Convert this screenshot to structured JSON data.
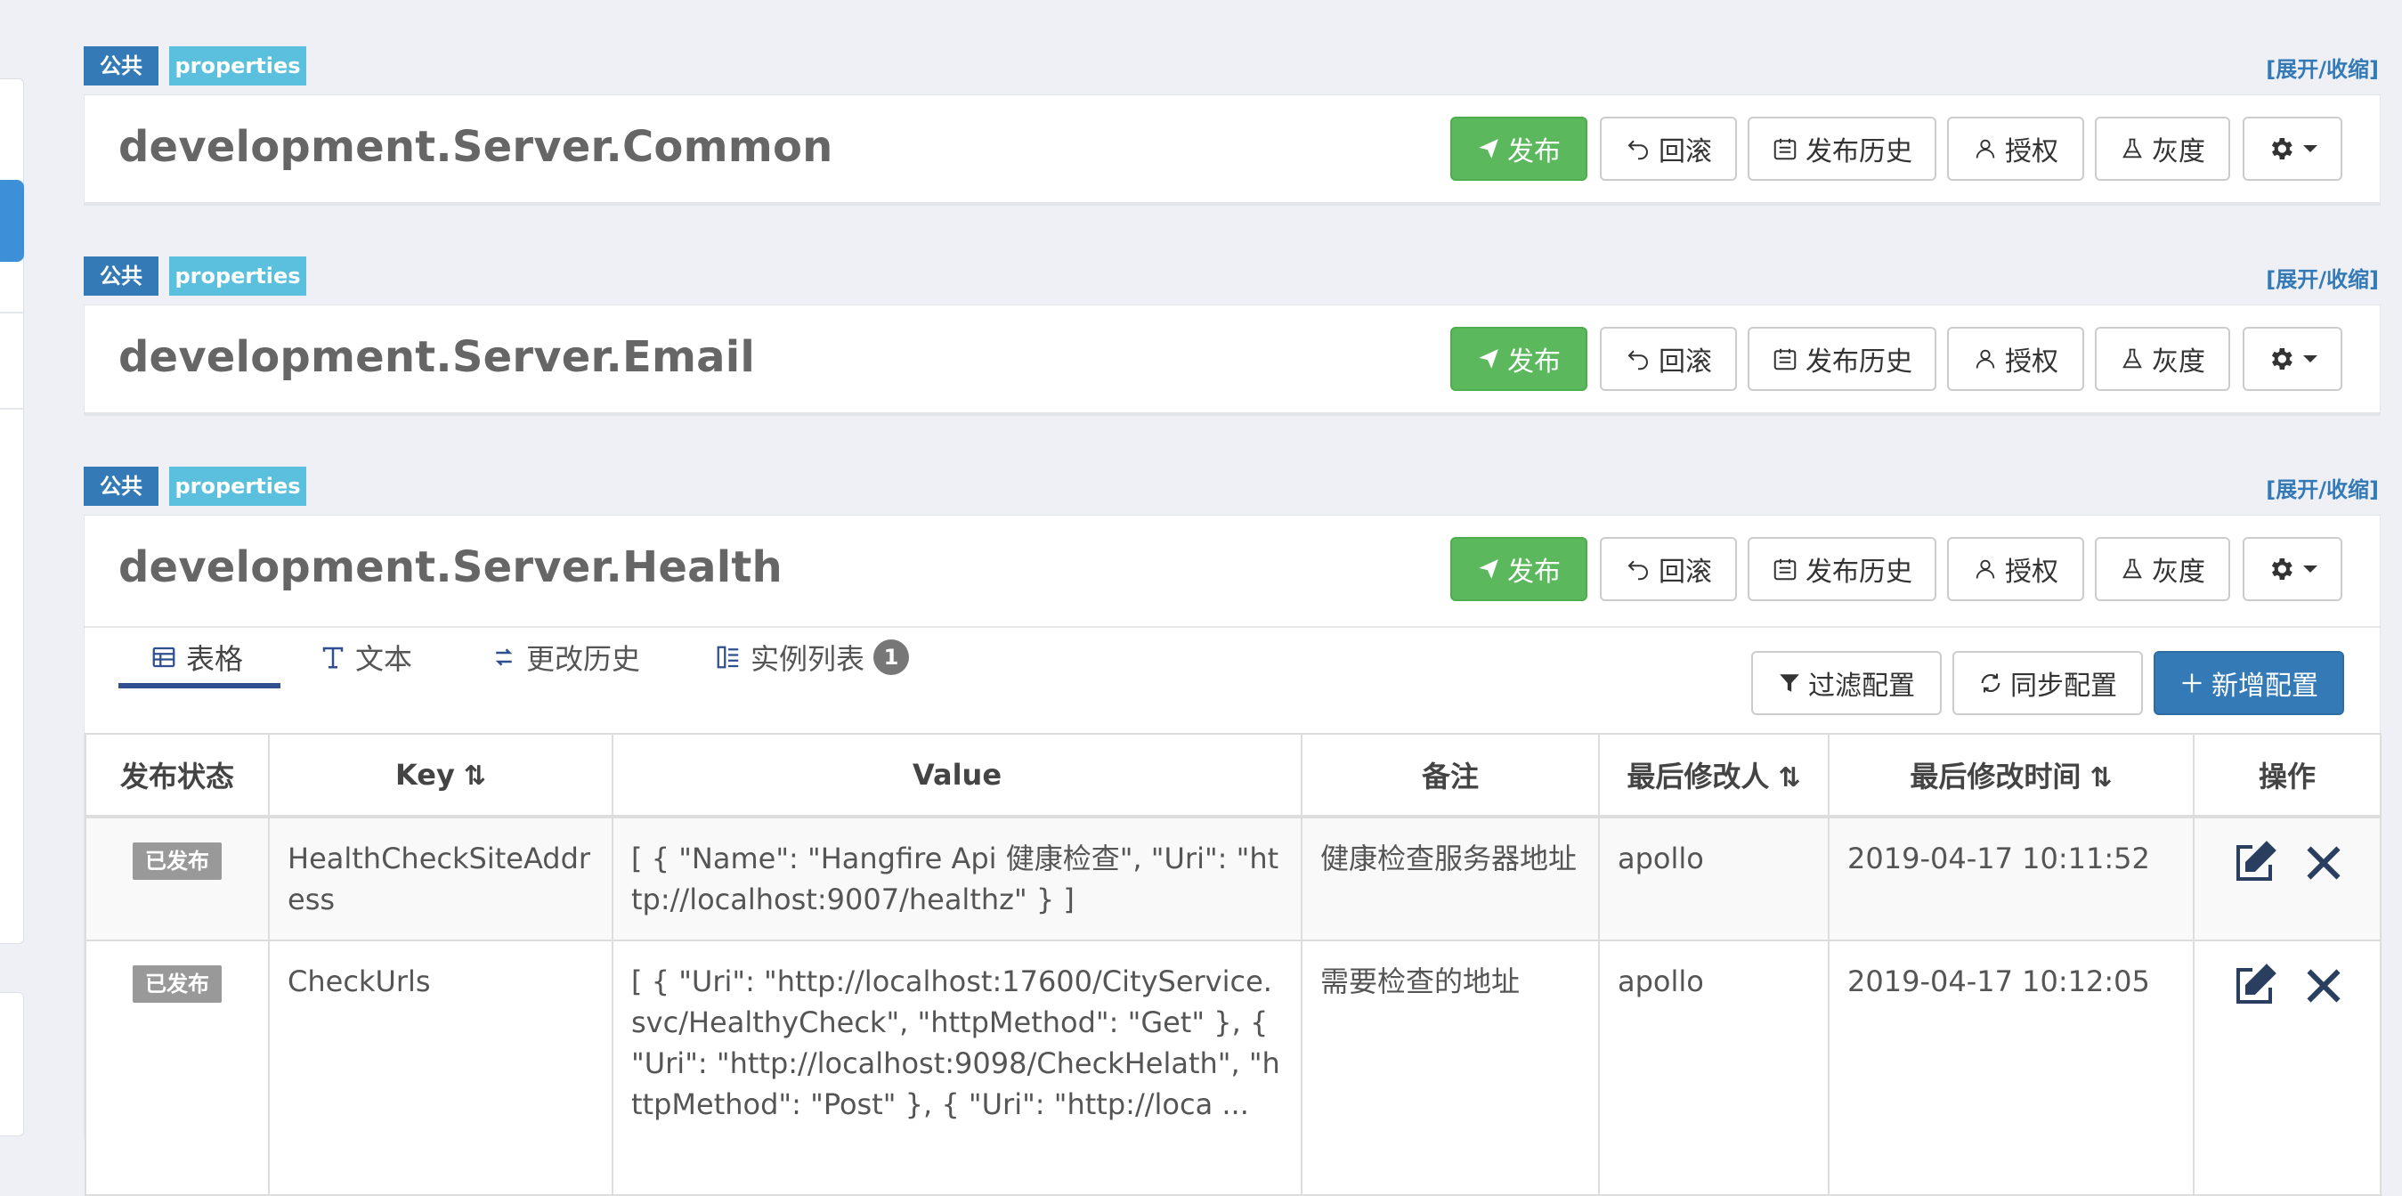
{
  "common": {
    "public_tag": "公共",
    "format_tag": "properties",
    "toggle_link": "[展开/收缩]",
    "buttons": {
      "publish": "发布",
      "rollback": "回滚",
      "history": "发布历史",
      "auth": "授权",
      "gray": "灰度"
    }
  },
  "namespaces": [
    {
      "title": "development.Server.Common"
    },
    {
      "title": "development.Server.Email"
    },
    {
      "title": "development.Server.Health"
    }
  ],
  "tabs": [
    {
      "label": "表格",
      "icon": "table-icon"
    },
    {
      "label": "文本",
      "icon": "text-icon"
    },
    {
      "label": "更改历史",
      "icon": "history-icon"
    },
    {
      "label": "实例列表",
      "icon": "instance-list-icon",
      "badge": "1"
    }
  ],
  "toolbar": {
    "filter": "过滤配置",
    "sync": "同步配置",
    "add": "新增配置"
  },
  "table": {
    "headers": {
      "status": "发布状态",
      "key": "Key",
      "value": "Value",
      "comment": "备注",
      "modifier": "最后修改人",
      "modified_time": "最后修改时间",
      "ops": "操作"
    },
    "rows": [
      {
        "status": "已发布",
        "key": "HealthCheckSiteAddress",
        "value": "[ { \"Name\": \"Hangfire Api 健康检查\", \"Uri\": \"http://localhost:9007/healthz\" } ]",
        "comment": "健康检查服务器地址",
        "modifier": "apollo",
        "modified_time": "2019-04-17 10:11:52"
      },
      {
        "status": "已发布",
        "key": "CheckUrls",
        "value": "[ { \"Uri\": \"http://localhost:17600/CityService.svc/HealthyCheck\", \"httpMethod\": \"Get\" }, { \"Uri\": \"http://localhost:9098/CheckHelath\", \"httpMethod\": \"Post\" }, { \"Uri\": \"http://loca ...",
        "comment": "需要检查的地址",
        "modifier": "apollo",
        "modified_time": "2019-04-17 10:12:05"
      }
    ]
  },
  "colors": {
    "publish_green": "#5cb85c",
    "primary_blue": "#337ab7",
    "info_cyan": "#5bc0de",
    "published_gray": "#999999"
  }
}
